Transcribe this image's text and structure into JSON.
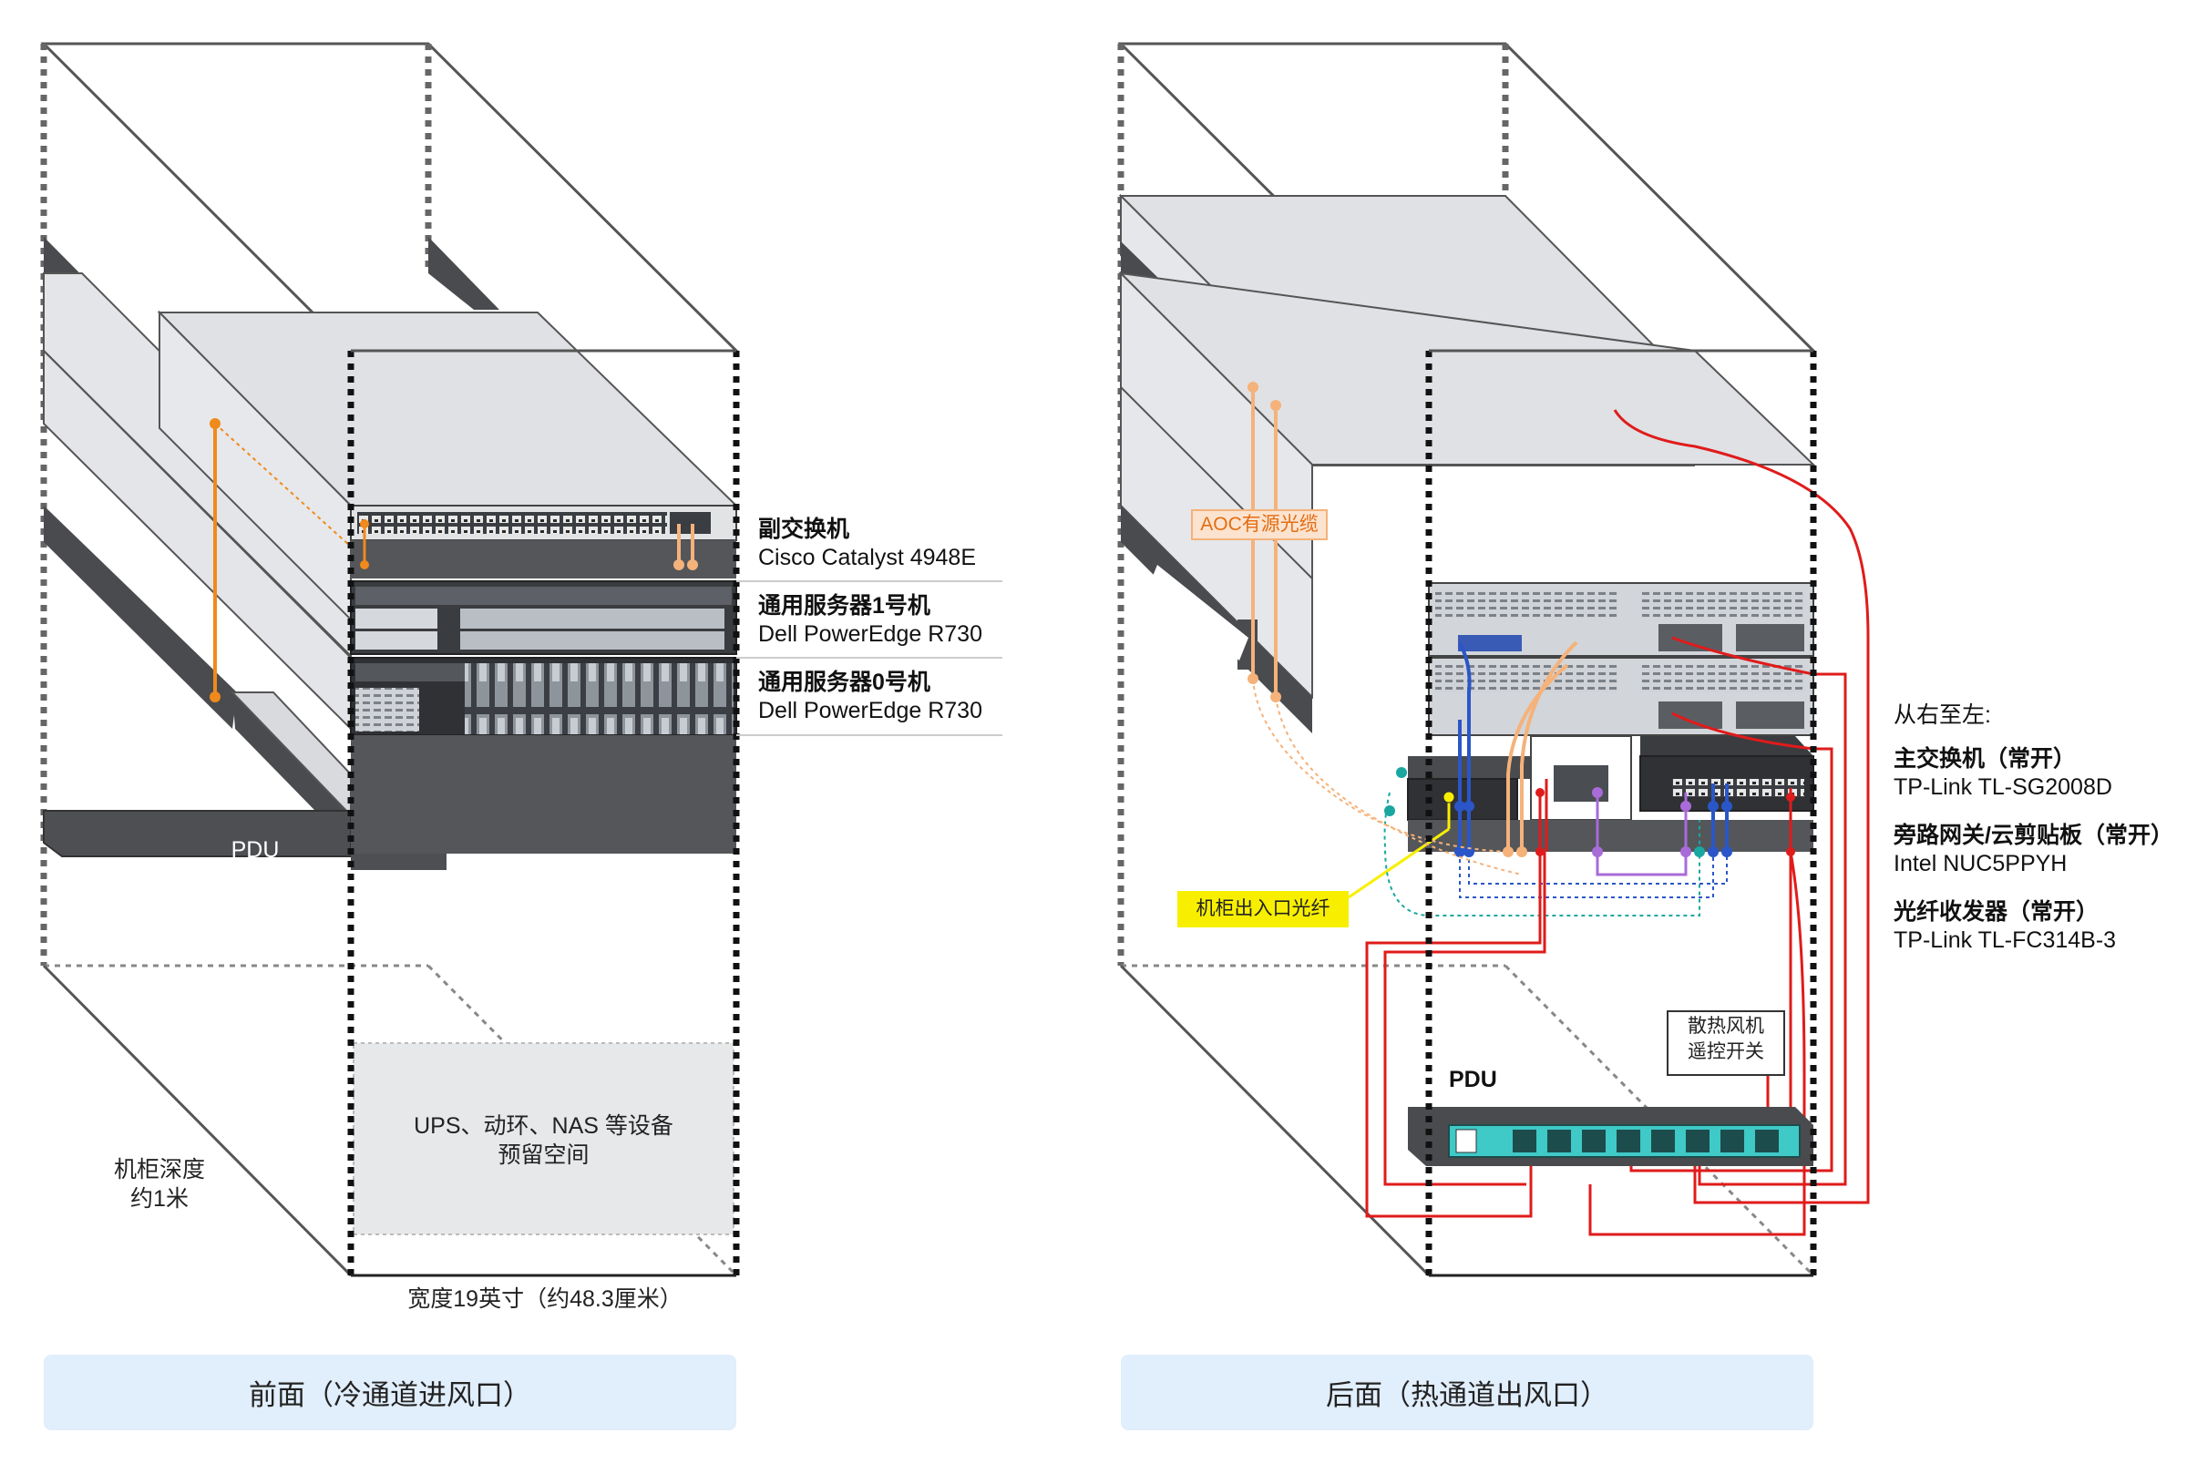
{
  "front": {
    "caption": "前面（冷通道进风口）",
    "pdu_label": "PDU",
    "depth_label_1": "机柜深度",
    "depth_label_2": "约1米",
    "width_label": "宽度19英寸（约48.3厘米）",
    "reserved_1": "UPS、动环、NAS 等设备",
    "reserved_2": "预留空间",
    "devices": [
      {
        "name": "副交换机",
        "model": "Cisco Catalyst 4948E"
      },
      {
        "name": "通用服务器1号机",
        "model": "Dell PowerEdge R730"
      },
      {
        "name": "通用服务器0号机",
        "model": "Dell PowerEdge R730"
      }
    ]
  },
  "back": {
    "caption": "后面（热通道出风口）",
    "aoc_label": "AOC有源光缆",
    "fiber_label": "机柜出入口光纤",
    "pdu_label": "PDU",
    "fan_switch_1": "散热风机",
    "fan_switch_2": "遥控开关",
    "order_title": "从右至左:",
    "devices": [
      {
        "name": "主交换机（常开）",
        "model": "TP-Link TL-SG2008D"
      },
      {
        "name": "旁路网关/云剪贴板（常开）",
        "model": "Intel NUC5PPYH"
      },
      {
        "name": "光纤收发器（常开）",
        "model": "TP-Link TL-FC314B-3"
      }
    ]
  },
  "colors": {
    "orange_cable": "#f08a1c",
    "light_orange_cable": "#f5b27a",
    "power_cable": "#e01b1b",
    "network_blue": "#2a56c8",
    "purple_cable": "#a86bd8",
    "teal_cable": "#1aa7a0",
    "fiber_yellow": "#f8ef00",
    "pdu_teal": "#3fc9c7",
    "caption_bg": "#e1eefb",
    "aoc_label_bg": "#fbe3cf"
  }
}
